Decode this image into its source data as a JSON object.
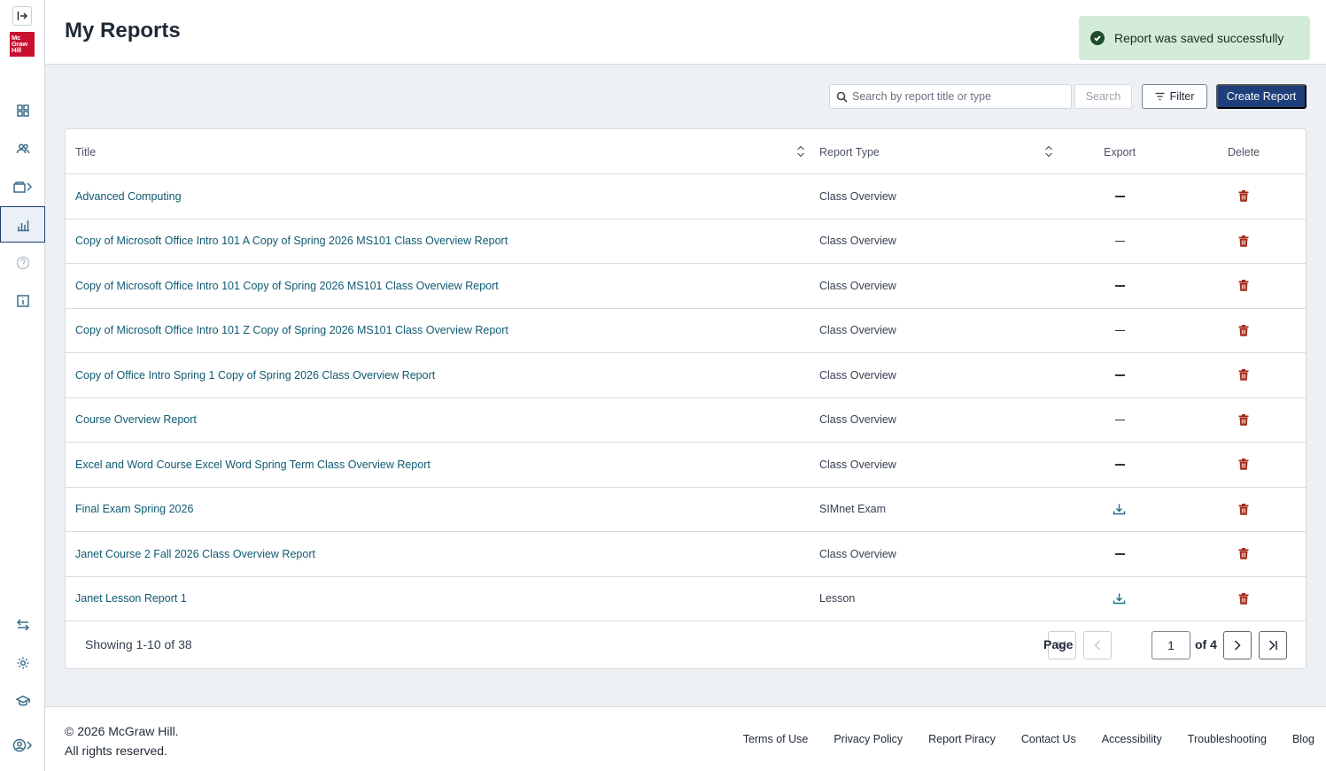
{
  "header": {
    "title": "My Reports"
  },
  "toast": {
    "message": "Report was saved successfully"
  },
  "toolbar": {
    "search_placeholder": "Search by report title or type",
    "search_label": "Search",
    "filter_label": "Filter",
    "create_label": "Create Report"
  },
  "table": {
    "columns": {
      "title": "Title",
      "type": "Report Type",
      "export": "Export",
      "delete": "Delete"
    },
    "rows": [
      {
        "title": "Advanced Computing",
        "type": "Class Overview",
        "export": "none"
      },
      {
        "title": "Copy of Microsoft Office Intro 101 A Copy of Spring 2026 MS101 Class Overview Report",
        "type": "Class Overview",
        "export": "none"
      },
      {
        "title": "Copy of Microsoft Office Intro 101 Copy of Spring 2026 MS101 Class Overview Report",
        "type": "Class Overview",
        "export": "none"
      },
      {
        "title": "Copy of Microsoft Office Intro 101 Z Copy of Spring 2026 MS101 Class Overview Report",
        "type": "Class Overview",
        "export": "none"
      },
      {
        "title": "Copy of Office Intro Spring 1 Copy of Spring 2026 Class Overview Report",
        "type": "Class Overview",
        "export": "none"
      },
      {
        "title": "Course Overview Report",
        "type": "Class Overview",
        "export": "none"
      },
      {
        "title": "Excel and Word Course Excel Word Spring Term Class Overview Report",
        "type": "Class Overview",
        "export": "none"
      },
      {
        "title": "Final Exam Spring 2026",
        "type": "SIMnet Exam",
        "export": "download"
      },
      {
        "title": "Janet Course 2 Fall 2026 Class Overview Report",
        "type": "Class Overview",
        "export": "none"
      },
      {
        "title": "Janet Lesson Report 1",
        "type": "Lesson",
        "export": "download"
      }
    ]
  },
  "pagination": {
    "showing": "Showing 1-10 of 38",
    "page_label": "Page",
    "current_page": "1",
    "of_label": "of 4"
  },
  "footer": {
    "copyright_line1": "© 2026 McGraw Hill.",
    "copyright_line2": "All rights reserved.",
    "links": [
      "Terms of Use",
      "Privacy Policy",
      "Report Piracy",
      "Contact Us",
      "Accessibility",
      "Troubleshooting",
      "Blog"
    ]
  },
  "logo": {
    "lines": [
      "Mc",
      "Graw",
      "Hill"
    ]
  },
  "colors": {
    "brand_red": "#c8102e",
    "primary_blue": "#1e3f7a",
    "link": "#0f5a72",
    "delete_red": "#a52a1a",
    "toast_bg": "#d3ecd9"
  },
  "icons": {
    "sidebar": [
      "collapse-icon",
      "dashboard-icon",
      "users-icon",
      "courses-icon",
      "reports-icon",
      "help-icon",
      "info-icon",
      "swap-icon",
      "settings-icon",
      "graduation-icon",
      "account-icon"
    ]
  }
}
